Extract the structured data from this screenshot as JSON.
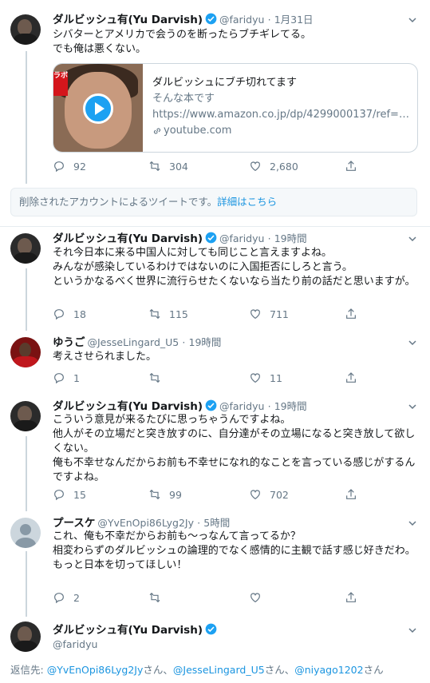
{
  "tweets": [
    {
      "name": "ダルビッシュ有(Yu Darvish)",
      "handle": "@faridyu",
      "dot": "·",
      "time": "1月31日",
      "text": "シバターとアメリカで会うのを断ったらブチギレてる。\nでも俺は悪くない。",
      "card": {
        "thumb_text": "ラボ",
        "title": "ダルビッシュにブチ切れてます",
        "description": "そんな本です",
        "url": "https://www.amazon.co.jp/dp/4299000137/ref=cm_s…",
        "domain": "youtube.com"
      },
      "replies": "92",
      "retweets": "304",
      "likes": "2,680"
    },
    {
      "name": "ダルビッシュ有(Yu Darvish)",
      "handle": "@faridyu",
      "dot": "·",
      "time": "19時間",
      "text": "それ今日本に来る中国人に対しても同じこと言えますよね。\nみんなが感染しているわけではないのに入国拒否にしろと言う。\nというかなるべく世界に流行らせたくないなら当たり前の話だと思いますが。",
      "replies": "18",
      "retweets": "115",
      "likes": "711"
    },
    {
      "name": "ゆうご",
      "handle": "@JesseLingard_U5",
      "dot": "·",
      "time": "19時間",
      "text": "考えさせられました。",
      "replies": "1",
      "retweets": "",
      "likes": "11"
    },
    {
      "name": "ダルビッシュ有(Yu Darvish)",
      "handle": "@faridyu",
      "dot": "·",
      "time": "19時間",
      "text": "こういう意見が来るたびに思っちゃうんですよね。\n他人がその立場だと突き放すのに、自分達がその立場になると突き放して欲しくない。\n俺も不幸せなんだからお前も不幸せになれ的なことを言っている感じがするんですよね。",
      "replies": "15",
      "retweets": "99",
      "likes": "702"
    },
    {
      "name": "プースケ",
      "handle": "@YvEnOpi86Lyg2Jy",
      "dot": "·",
      "time": "5時間",
      "text": "これ、俺も不幸だからお前も〜っなんて言ってるか？\n相変わらずのダルビッシュの論理的でなく感情的に主観で話す感じ好きだわ。\nもっと日本を切ってほしい！",
      "replies": "2",
      "retweets": "",
      "likes": ""
    },
    {
      "name": "ダルビッシュ有(Yu Darvish)",
      "handle": "@faridyu"
    }
  ],
  "deleted_notice": {
    "text": "削除されたアカウントによるツイートです。",
    "link": "詳細はこちら"
  },
  "reply_to": {
    "label": "返信先: ",
    "mentions": [
      "@YvEnOpi86Lyg2Jy",
      "@JesseLingard_U5",
      "@niyago1202"
    ],
    "suffix": "さん",
    "separator": "、"
  },
  "colors": {
    "accent": "#1da1f2",
    "link": "#1b95e0",
    "muted": "#657786"
  }
}
